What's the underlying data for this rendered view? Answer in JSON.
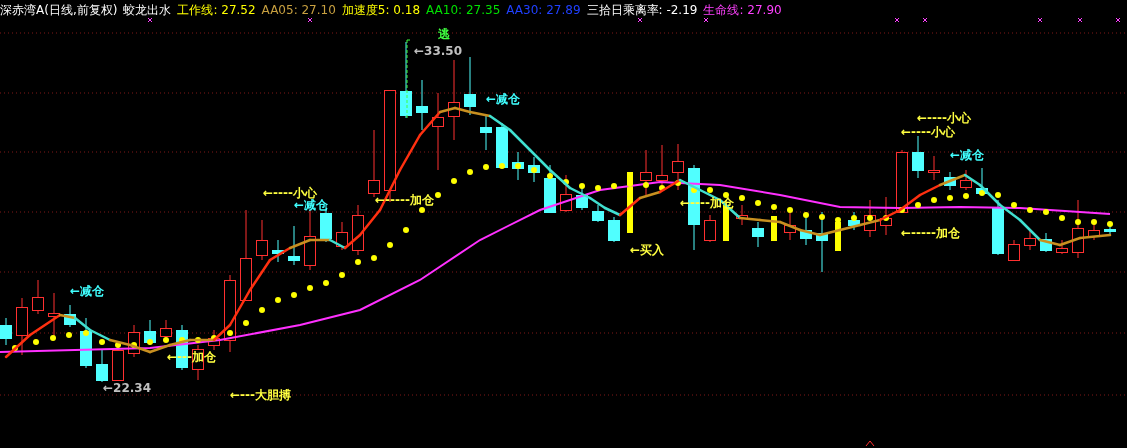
{
  "header": {
    "title": "深赤湾A(日线,前复权)",
    "indicator_name": "蛟龙出水",
    "values": [
      {
        "label": "工作线: 27.52",
        "color": "#ffff00"
      },
      {
        "label": "AA05: 27.10",
        "color": "#c8a040"
      },
      {
        "label": "加速度5: 0.18",
        "color": "#ffff00"
      },
      {
        "label": "AA10: 27.35",
        "color": "#00e000"
      },
      {
        "label": "AA30: 27.89",
        "color": "#2040ff"
      },
      {
        "label": "三拾日乘离率: -2.19",
        "color": "#ffffff"
      },
      {
        "label": "生命线: 27.90",
        "color": "#ff40ff"
      }
    ]
  },
  "annotations": [
    {
      "text": "←减仓",
      "color": "#40ffff"
    },
    {
      "text": "←22.34",
      "color": "#c0c0c0"
    },
    {
      "text": "←---加仓",
      "color": "#ffff40"
    },
    {
      "text": "←---大胆搏",
      "color": "#ffff40"
    },
    {
      "text": "←----小心",
      "color": "#ffff40"
    },
    {
      "text": "←减仓",
      "color": "#40ffff"
    },
    {
      "text": "←-----加仓",
      "color": "#ffff40"
    },
    {
      "text": "逃",
      "color": "#40ff40"
    },
    {
      "text": "←33.50",
      "color": "#c0c0c0"
    },
    {
      "text": "←减仓",
      "color": "#40ffff"
    },
    {
      "text": "←买入",
      "color": "#ffff40"
    },
    {
      "text": "←----加仓",
      "color": "#ffff40"
    },
    {
      "text": "←----小心",
      "color": "#ffff40"
    },
    {
      "text": "←----小心",
      "color": "#ffff40"
    },
    {
      "text": "←减仓",
      "color": "#40ffff"
    },
    {
      "text": "←-----加仓",
      "color": "#ffff40"
    }
  ]
}
